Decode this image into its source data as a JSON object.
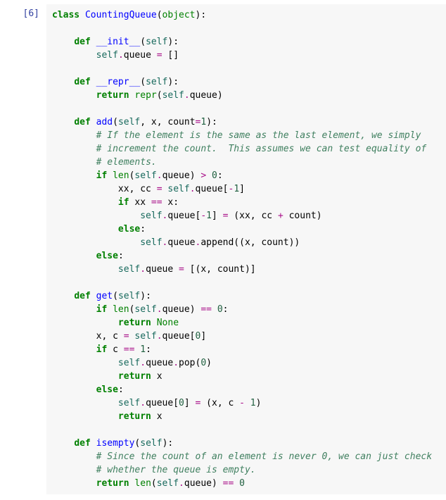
{
  "cell": {
    "prompt": "[6]",
    "lines": [
      [
        [
          "kw",
          "class"
        ],
        [
          "txt",
          " "
        ],
        [
          "cls",
          "CountingQueue"
        ],
        [
          "txt",
          "("
        ],
        [
          "builtin",
          "object"
        ],
        [
          "txt",
          "):"
        ]
      ],
      [],
      [
        [
          "txt",
          "    "
        ],
        [
          "kw",
          "def"
        ],
        [
          "txt",
          " "
        ],
        [
          "cls",
          "__init__"
        ],
        [
          "txt",
          "("
        ],
        [
          "self",
          "self"
        ],
        [
          "txt",
          "):"
        ]
      ],
      [
        [
          "txt",
          "        "
        ],
        [
          "self",
          "self"
        ],
        [
          "op",
          "."
        ],
        [
          "txt",
          "queue "
        ],
        [
          "op",
          "="
        ],
        [
          "txt",
          " []"
        ]
      ],
      [],
      [
        [
          "txt",
          "    "
        ],
        [
          "kw",
          "def"
        ],
        [
          "txt",
          " "
        ],
        [
          "cls",
          "__repr__"
        ],
        [
          "txt",
          "("
        ],
        [
          "self",
          "self"
        ],
        [
          "txt",
          "):"
        ]
      ],
      [
        [
          "txt",
          "        "
        ],
        [
          "kw",
          "return"
        ],
        [
          "txt",
          " "
        ],
        [
          "builtin",
          "repr"
        ],
        [
          "txt",
          "("
        ],
        [
          "self",
          "self"
        ],
        [
          "op",
          "."
        ],
        [
          "txt",
          "queue)"
        ]
      ],
      [],
      [
        [
          "txt",
          "    "
        ],
        [
          "kw",
          "def"
        ],
        [
          "txt",
          " "
        ],
        [
          "cls",
          "add"
        ],
        [
          "txt",
          "("
        ],
        [
          "self",
          "self"
        ],
        [
          "txt",
          ", x, count"
        ],
        [
          "op",
          "="
        ],
        [
          "num",
          "1"
        ],
        [
          "txt",
          "):"
        ]
      ],
      [
        [
          "txt",
          "        "
        ],
        [
          "cmt",
          "# If the element is the same as the last element, we simply"
        ]
      ],
      [
        [
          "txt",
          "        "
        ],
        [
          "cmt",
          "# increment the count.  This assumes we can test equality of"
        ]
      ],
      [
        [
          "txt",
          "        "
        ],
        [
          "cmt",
          "# elements."
        ]
      ],
      [
        [
          "txt",
          "        "
        ],
        [
          "kw",
          "if"
        ],
        [
          "txt",
          " "
        ],
        [
          "builtin",
          "len"
        ],
        [
          "txt",
          "("
        ],
        [
          "self",
          "self"
        ],
        [
          "op",
          "."
        ],
        [
          "txt",
          "queue) "
        ],
        [
          "op",
          ">"
        ],
        [
          "txt",
          " "
        ],
        [
          "num",
          "0"
        ],
        [
          "txt",
          ":"
        ]
      ],
      [
        [
          "txt",
          "            xx, cc "
        ],
        [
          "op",
          "="
        ],
        [
          "txt",
          " "
        ],
        [
          "self",
          "self"
        ],
        [
          "op",
          "."
        ],
        [
          "txt",
          "queue["
        ],
        [
          "op",
          "-"
        ],
        [
          "num",
          "1"
        ],
        [
          "txt",
          "]"
        ]
      ],
      [
        [
          "txt",
          "            "
        ],
        [
          "kw",
          "if"
        ],
        [
          "txt",
          " xx "
        ],
        [
          "op",
          "=="
        ],
        [
          "txt",
          " x:"
        ]
      ],
      [
        [
          "txt",
          "                "
        ],
        [
          "self",
          "self"
        ],
        [
          "op",
          "."
        ],
        [
          "txt",
          "queue["
        ],
        [
          "op",
          "-"
        ],
        [
          "num",
          "1"
        ],
        [
          "txt",
          "] "
        ],
        [
          "op",
          "="
        ],
        [
          "txt",
          " (xx, cc "
        ],
        [
          "op",
          "+"
        ],
        [
          "txt",
          " count)"
        ]
      ],
      [
        [
          "txt",
          "            "
        ],
        [
          "kw",
          "else"
        ],
        [
          "txt",
          ":"
        ]
      ],
      [
        [
          "txt",
          "                "
        ],
        [
          "self",
          "self"
        ],
        [
          "op",
          "."
        ],
        [
          "txt",
          "queue"
        ],
        [
          "op",
          "."
        ],
        [
          "txt",
          "append((x, count))"
        ]
      ],
      [
        [
          "txt",
          "        "
        ],
        [
          "kw",
          "else"
        ],
        [
          "txt",
          ":"
        ]
      ],
      [
        [
          "txt",
          "            "
        ],
        [
          "self",
          "self"
        ],
        [
          "op",
          "."
        ],
        [
          "txt",
          "queue "
        ],
        [
          "op",
          "="
        ],
        [
          "txt",
          " [(x, count)]"
        ]
      ],
      [],
      [
        [
          "txt",
          "    "
        ],
        [
          "kw",
          "def"
        ],
        [
          "txt",
          " "
        ],
        [
          "cls",
          "get"
        ],
        [
          "txt",
          "("
        ],
        [
          "self",
          "self"
        ],
        [
          "txt",
          "):"
        ]
      ],
      [
        [
          "txt",
          "        "
        ],
        [
          "kw",
          "if"
        ],
        [
          "txt",
          " "
        ],
        [
          "builtin",
          "len"
        ],
        [
          "txt",
          "("
        ],
        [
          "self",
          "self"
        ],
        [
          "op",
          "."
        ],
        [
          "txt",
          "queue) "
        ],
        [
          "op",
          "=="
        ],
        [
          "txt",
          " "
        ],
        [
          "num",
          "0"
        ],
        [
          "txt",
          ":"
        ]
      ],
      [
        [
          "txt",
          "            "
        ],
        [
          "kw",
          "return"
        ],
        [
          "txt",
          " "
        ],
        [
          "builtin",
          "None"
        ]
      ],
      [
        [
          "txt",
          "        x, c "
        ],
        [
          "op",
          "="
        ],
        [
          "txt",
          " "
        ],
        [
          "self",
          "self"
        ],
        [
          "op",
          "."
        ],
        [
          "txt",
          "queue["
        ],
        [
          "num",
          "0"
        ],
        [
          "txt",
          "]"
        ]
      ],
      [
        [
          "txt",
          "        "
        ],
        [
          "kw",
          "if"
        ],
        [
          "txt",
          " c "
        ],
        [
          "op",
          "=="
        ],
        [
          "txt",
          " "
        ],
        [
          "num",
          "1"
        ],
        [
          "txt",
          ":"
        ]
      ],
      [
        [
          "txt",
          "            "
        ],
        [
          "self",
          "self"
        ],
        [
          "op",
          "."
        ],
        [
          "txt",
          "queue"
        ],
        [
          "op",
          "."
        ],
        [
          "txt",
          "pop("
        ],
        [
          "num",
          "0"
        ],
        [
          "txt",
          ")"
        ]
      ],
      [
        [
          "txt",
          "            "
        ],
        [
          "kw",
          "return"
        ],
        [
          "txt",
          " x"
        ]
      ],
      [
        [
          "txt",
          "        "
        ],
        [
          "kw",
          "else"
        ],
        [
          "txt",
          ":"
        ]
      ],
      [
        [
          "txt",
          "            "
        ],
        [
          "self",
          "self"
        ],
        [
          "op",
          "."
        ],
        [
          "txt",
          "queue["
        ],
        [
          "num",
          "0"
        ],
        [
          "txt",
          "] "
        ],
        [
          "op",
          "="
        ],
        [
          "txt",
          " (x, c "
        ],
        [
          "op",
          "-"
        ],
        [
          "txt",
          " "
        ],
        [
          "num",
          "1"
        ],
        [
          "txt",
          ")"
        ]
      ],
      [
        [
          "txt",
          "            "
        ],
        [
          "kw",
          "return"
        ],
        [
          "txt",
          " x"
        ]
      ],
      [],
      [
        [
          "txt",
          "    "
        ],
        [
          "kw",
          "def"
        ],
        [
          "txt",
          " "
        ],
        [
          "cls",
          "isempty"
        ],
        [
          "txt",
          "("
        ],
        [
          "self",
          "self"
        ],
        [
          "txt",
          "):"
        ]
      ],
      [
        [
          "txt",
          "        "
        ],
        [
          "cmt",
          "# Since the count of an element is never 0, we can just check"
        ]
      ],
      [
        [
          "txt",
          "        "
        ],
        [
          "cmt",
          "# whether the queue is empty."
        ]
      ],
      [
        [
          "txt",
          "        "
        ],
        [
          "kw",
          "return"
        ],
        [
          "txt",
          " "
        ],
        [
          "builtin",
          "len"
        ],
        [
          "txt",
          "("
        ],
        [
          "self",
          "self"
        ],
        [
          "op",
          "."
        ],
        [
          "txt",
          "queue) "
        ],
        [
          "op",
          "=="
        ],
        [
          "txt",
          " "
        ],
        [
          "num",
          "0"
        ]
      ]
    ]
  }
}
